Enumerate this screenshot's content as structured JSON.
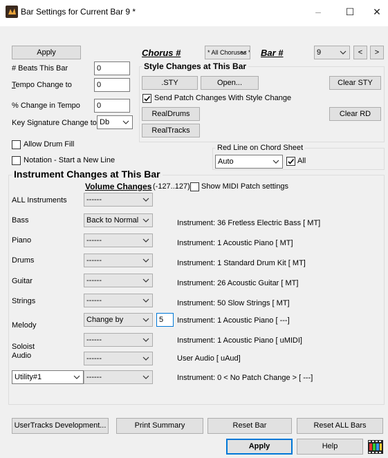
{
  "window": {
    "title": "Bar Settings for Current Bar 9 *",
    "minimize": "–",
    "maximize": "☐",
    "close": "✕"
  },
  "left": {
    "apply": "Apply",
    "beats_label": "# Beats This Bar",
    "beats_value": "0",
    "tempo_label": "Tempo Change to",
    "tempo_value": "0",
    "pct_label": "% Change in Tempo",
    "pct_value": "0",
    "key_label": "Key Signature Change to",
    "key_value": "Db",
    "allow_drum_fill": "Allow Drum Fill",
    "allow_drum_fill_checked": false,
    "notation_new_line": "Notation - Start a New Line",
    "notation_new_line_checked": false
  },
  "top": {
    "chorus_label": "Chorus #",
    "chorus_value": "* All Choruses *",
    "bar_label": "Bar #",
    "bar_value": "9",
    "prev": "<",
    "next": ">"
  },
  "style": {
    "title": "Style Changes at This Bar",
    "sty_button": ".STY",
    "open_button": "Open...",
    "clear_sty": "Clear STY",
    "send_patch": "Send Patch Changes With Style Change",
    "send_patch_checked": true,
    "realdrums": "RealDrums",
    "clear_rd": "Clear RD",
    "realtracks": "RealTracks"
  },
  "redline": {
    "title": "Red Line on Chord Sheet",
    "value": "Auto",
    "all_label": "All",
    "all_checked": true
  },
  "instruments": {
    "title": "Instrument Changes at This Bar",
    "volume_header": "Volume Changes",
    "volume_range": "(-127..127)",
    "show_midi": "Show MIDI Patch settings",
    "show_midi_checked": false,
    "rows": [
      {
        "name": "ALL Instruments",
        "volume": "------",
        "info": ""
      },
      {
        "name": "Bass",
        "volume": "Back to Normal",
        "info": "Instrument: 36 Fretless Electric Bass [ MT]"
      },
      {
        "name": "Piano",
        "volume": "------",
        "info": "Instrument: 1 Acoustic Piano [ MT]"
      },
      {
        "name": "Drums",
        "volume": "------",
        "info": "Instrument: 1 Standard Drum Kit [ MT]"
      },
      {
        "name": "Guitar",
        "volume": "------",
        "info": "Instrument: 26 Acoustic Guitar [ MT]"
      },
      {
        "name": "Strings",
        "volume": "------",
        "info": "Instrument: 50 Slow Strings [ MT]"
      },
      {
        "name": "Melody",
        "volume": "Change by",
        "amount": "5",
        "info": "Instrument: 1 Acoustic Piano [ ---]"
      },
      {
        "name": "Soloist",
        "volume": "------",
        "info": "Instrument: 1 Acoustic Piano [ uMIDI]"
      },
      {
        "name": "Audio",
        "volume": "------",
        "info": "User Audio [ uAud]"
      },
      {
        "name": "Utility#1",
        "volume": "------",
        "info": "Instrument: 0 < No Patch Change > [ ---]"
      }
    ]
  },
  "bottom": {
    "usertracks": "UserTracks Development...",
    "print_summary": "Print Summary",
    "reset_bar": "Reset Bar",
    "reset_all": "Reset ALL Bars",
    "apply": "Apply",
    "help": "Help"
  }
}
